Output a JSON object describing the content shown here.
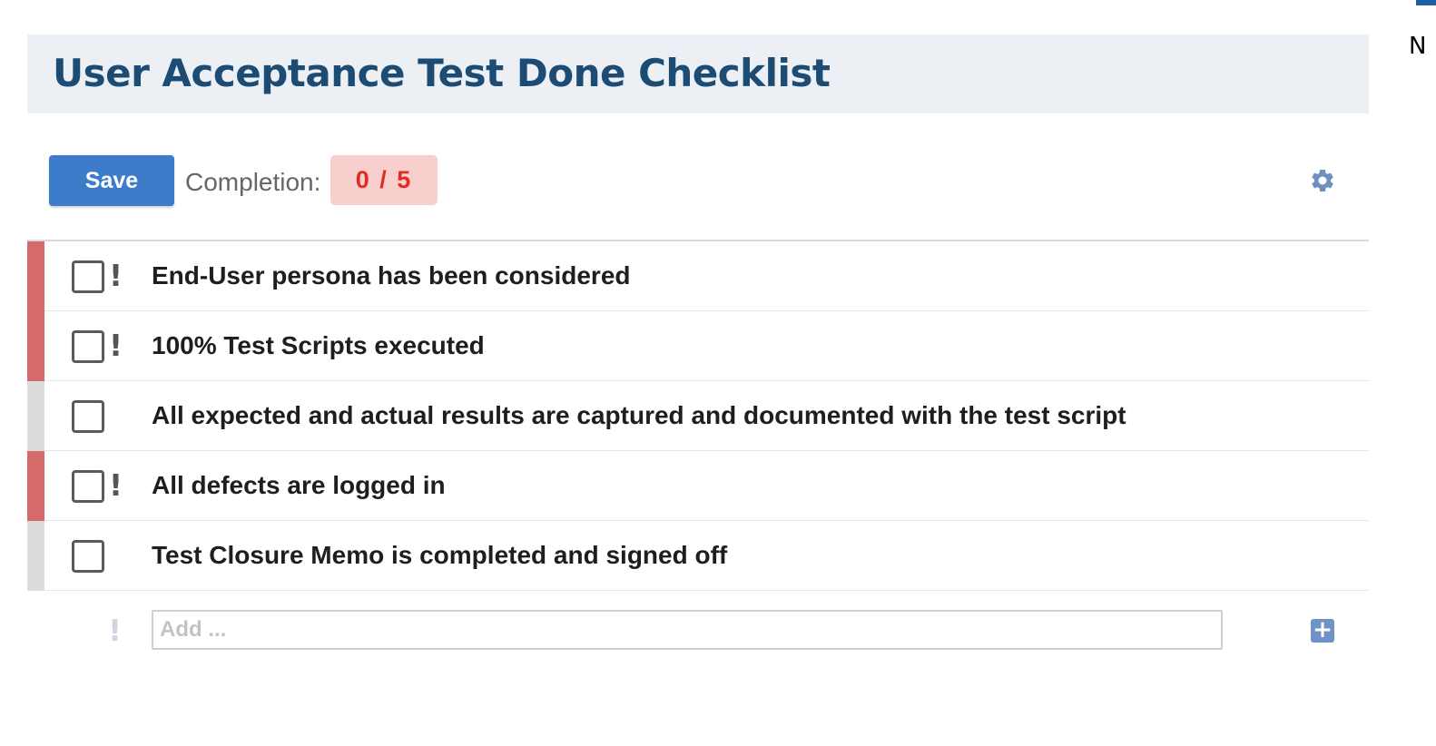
{
  "header": {
    "title": "User Acceptance Test Done Checklist"
  },
  "toolbar": {
    "save_label": "Save",
    "completion_label": "Completion:",
    "completion_value": "0 / 5",
    "settings_icon": "gear-icon"
  },
  "colors": {
    "required_strip": "#d46a6a",
    "optional_strip": "#dcdcdc",
    "badge_bg": "#f8cfcc",
    "badge_text": "#e02c22",
    "accent": "#3d7cc9"
  },
  "items": [
    {
      "text": "End-User persona has been considered",
      "checked": false,
      "required": true
    },
    {
      "text": "100% Test Scripts executed",
      "checked": false,
      "required": true
    },
    {
      "text": "All expected and actual results are captured and documented with the test script",
      "checked": false,
      "required": false
    },
    {
      "text": "All defects are logged in",
      "checked": false,
      "required": true
    },
    {
      "text": "Test Closure Memo is completed and signed off",
      "checked": false,
      "required": false
    }
  ],
  "add": {
    "placeholder": "Add ...",
    "add_icon": "plus-square-icon"
  },
  "edge": {
    "partial_text": "N"
  }
}
